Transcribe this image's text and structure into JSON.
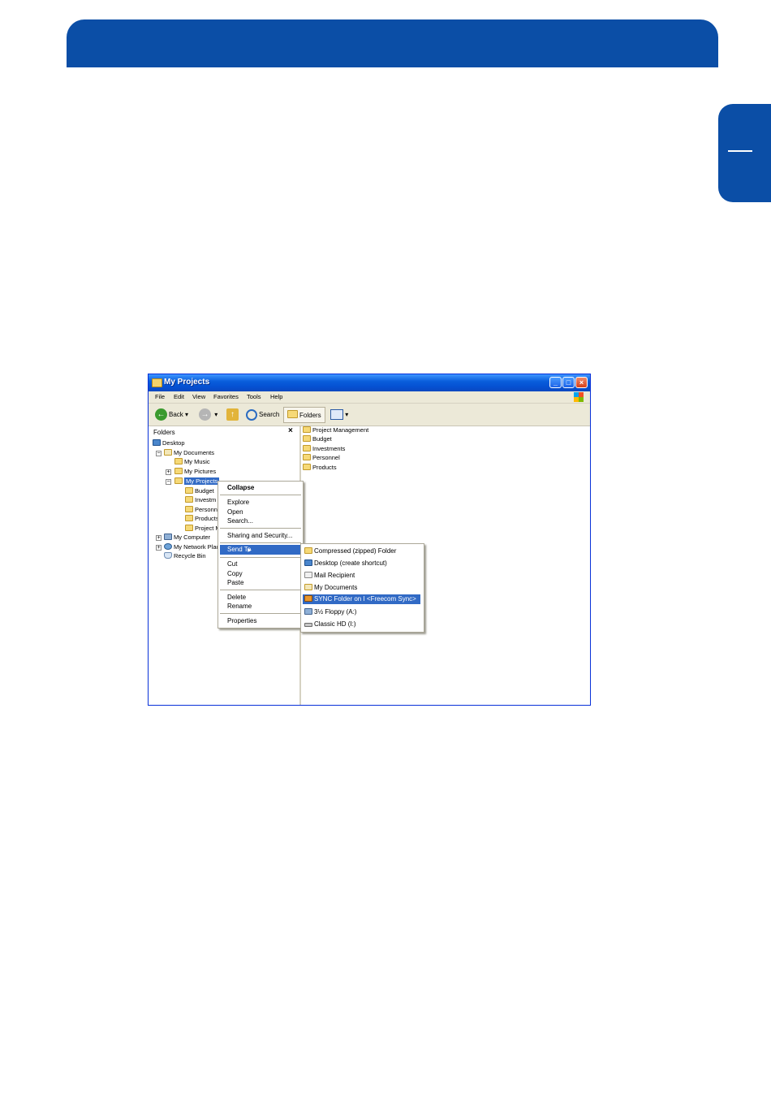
{
  "window": {
    "title": "My Projects",
    "menu": [
      "File",
      "Edit",
      "View",
      "Favorites",
      "Tools",
      "Help"
    ],
    "toolbar": {
      "back": "Back",
      "search": "Search",
      "folders": "Folders"
    },
    "pane_title": "Folders",
    "pane_close": "×"
  },
  "tree": {
    "desktop": "Desktop",
    "my_documents": "My Documents",
    "my_music": "My Music",
    "my_pictures": "My Pictures",
    "my_projects": "My Projects",
    "budget": "Budget",
    "investments": "Investm",
    "personnel": "Personn",
    "products": "Products",
    "project": "Project M",
    "my_computer": "My Computer",
    "my_network": "My Network Plac",
    "recycle_bin": "Recycle Bin"
  },
  "file_list": [
    "Project Management",
    "Budget",
    "Investments",
    "Personnel",
    "Products"
  ],
  "context_menu": {
    "collapse": "Collapse",
    "explore": "Explore",
    "open": "Open",
    "search": "Search...",
    "sharing": "Sharing and Security...",
    "send_to": "Send To",
    "cut": "Cut",
    "copy": "Copy",
    "paste": "Paste",
    "delete": "Delete",
    "rename": "Rename",
    "properties": "Properties"
  },
  "send_to_menu": {
    "compressed": "Compressed (zipped) Folder",
    "desktop": "Desktop (create shortcut)",
    "mail": "Mail Recipient",
    "my_documents": "My Documents",
    "sync": "SYNC Folder on I <Freecom Sync>",
    "floppy": "3½ Floppy (A:)",
    "classic_hd": "Classic HD (I:)"
  },
  "colors": {
    "brand_blue": "#0b4ea6",
    "selection": "#316ac5"
  }
}
